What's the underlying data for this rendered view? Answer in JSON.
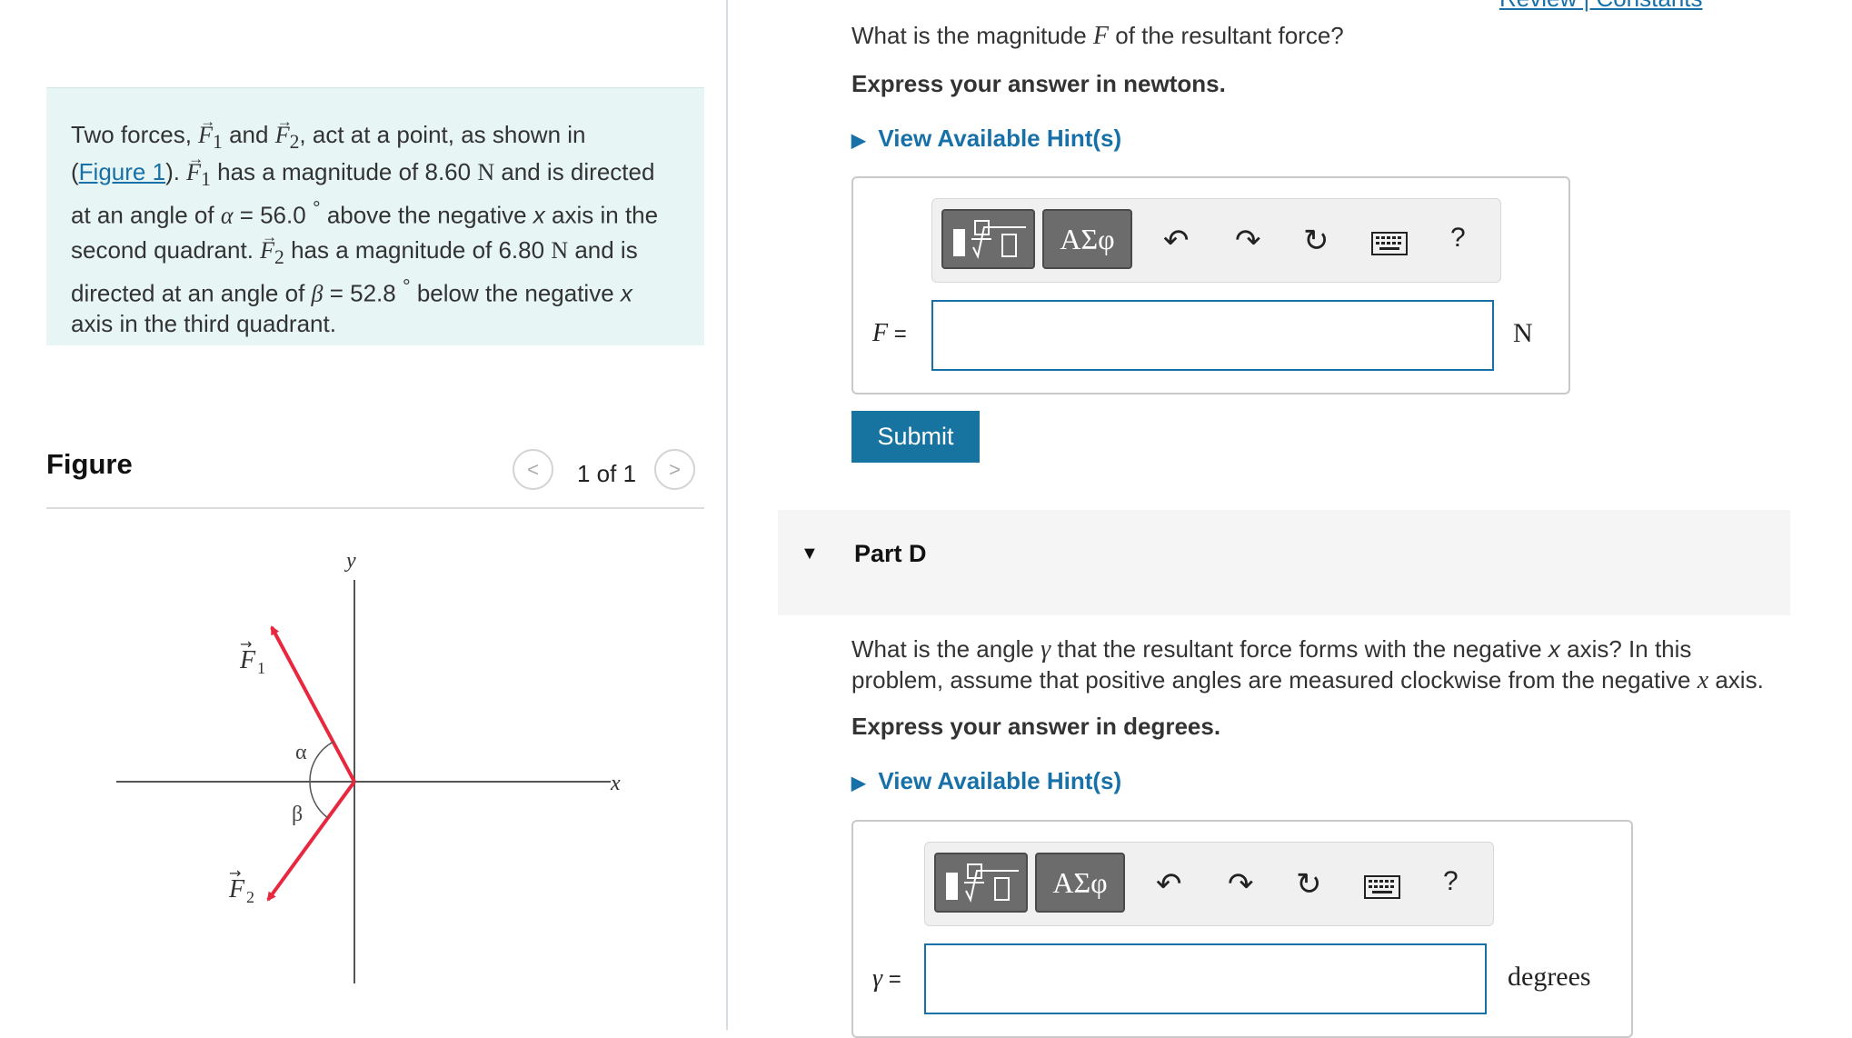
{
  "header": {
    "links_partial": "Review | Constants"
  },
  "problem": {
    "t1": "Two forces, ",
    "f1": "F",
    "sub1": "1",
    "t2": " and ",
    "f2": "F",
    "sub2": "2",
    "t3": ", act at a point, as shown in",
    "open_paren": "(",
    "figure_link": "Figure 1",
    "close_paren": "). ",
    "f1b": "F",
    "sub1b": "1",
    "t4": " has a magnitude of 8.60 ",
    "unit_n1": "N",
    "t5": " and is directed",
    "t6": "at an angle of ",
    "alpha": "α",
    "t7": " = 56.0 ",
    "deg1": "°",
    "t8": " above the negative ",
    "x1": "x",
    "t9": " axis in the",
    "t10": "second quadrant. ",
    "f2b": "F",
    "sub2b": "2",
    "t11": " has a magnitude of 6.80 ",
    "unit_n2": "N",
    "t12": " and is",
    "t13": "directed at an angle of ",
    "beta": "β",
    "t14": " = 52.8 ",
    "deg2": "°",
    "t15": " below the negative ",
    "x2": "x",
    "t16": "axis in the third quadrant."
  },
  "figure": {
    "title": "Figure",
    "pager": "1 of 1",
    "prev_symbol": "<",
    "next_symbol": ">",
    "labels": {
      "y": "y",
      "x": "x",
      "alpha": "α",
      "beta": "β",
      "F1": "F",
      "F1_sub": "1",
      "F2": "F",
      "F2_sub": "2"
    },
    "colors": {
      "force": "#e8283e",
      "axes": "#555555"
    }
  },
  "part_c": {
    "question_a": "What is the magnitude ",
    "question_var": "F",
    "question_b": " of the resultant force?",
    "instruction": "Express your answer in newtons.",
    "hint": "View Available Hint(s)",
    "toolbar": {
      "greek": "ΑΣφ",
      "help": "?"
    },
    "var_label": "F",
    "equals": " =",
    "input_value": "",
    "unit": "N",
    "submit": "Submit"
  },
  "part_d": {
    "title": "Part D",
    "question_a": "What is the angle ",
    "gamma": "γ",
    "question_b": " that the resultant force forms with the negative ",
    "x_var": "x",
    "question_c": " axis? In this",
    "question_d": "problem, assume that positive angles are measured  clockwise from the negative ",
    "x_var2": "x",
    "question_e": " axis.",
    "instruction": "Express your answer in degrees.",
    "hint": "View Available Hint(s)",
    "toolbar": {
      "greek": "ΑΣφ",
      "help": "?"
    },
    "var_label": "γ",
    "equals": " =",
    "input_value": "",
    "unit": "degrees"
  },
  "colors": {
    "accent": "#1771a8",
    "submit_bg": "#17739f",
    "problem_bg": "#e7f5f5"
  }
}
